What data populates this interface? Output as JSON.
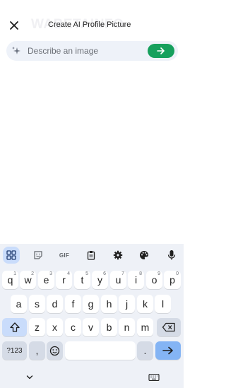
{
  "header": {
    "title": "Create AI Profile Picture",
    "watermark": "WABETAINFO"
  },
  "prompt": {
    "placeholder": "Describe an image"
  },
  "keyboard": {
    "toolbar": {
      "gif_label": "GIF"
    },
    "rows": [
      [
        {
          "l": "q",
          "s": "1"
        },
        {
          "l": "w",
          "s": "2"
        },
        {
          "l": "e",
          "s": "3"
        },
        {
          "l": "r",
          "s": "4"
        },
        {
          "l": "t",
          "s": "5"
        },
        {
          "l": "y",
          "s": "6"
        },
        {
          "l": "u",
          "s": "7"
        },
        {
          "l": "i",
          "s": "8"
        },
        {
          "l": "o",
          "s": "9"
        },
        {
          "l": "p",
          "s": "0"
        }
      ],
      [
        {
          "l": "a"
        },
        {
          "l": "s"
        },
        {
          "l": "d"
        },
        {
          "l": "f"
        },
        {
          "l": "g"
        },
        {
          "l": "h"
        },
        {
          "l": "j"
        },
        {
          "l": "k"
        },
        {
          "l": "l"
        }
      ],
      [
        {
          "l": "z"
        },
        {
          "l": "x"
        },
        {
          "l": "c"
        },
        {
          "l": "v"
        },
        {
          "l": "b"
        },
        {
          "l": "n"
        },
        {
          "l": "m"
        }
      ]
    ],
    "symbols_label": "?123",
    "comma_label": ",",
    "period_label": "."
  },
  "colors": {
    "send_button": "#16a05d",
    "keyboard_bg": "#eef1f7",
    "accent_blue": "#84b4f4"
  }
}
